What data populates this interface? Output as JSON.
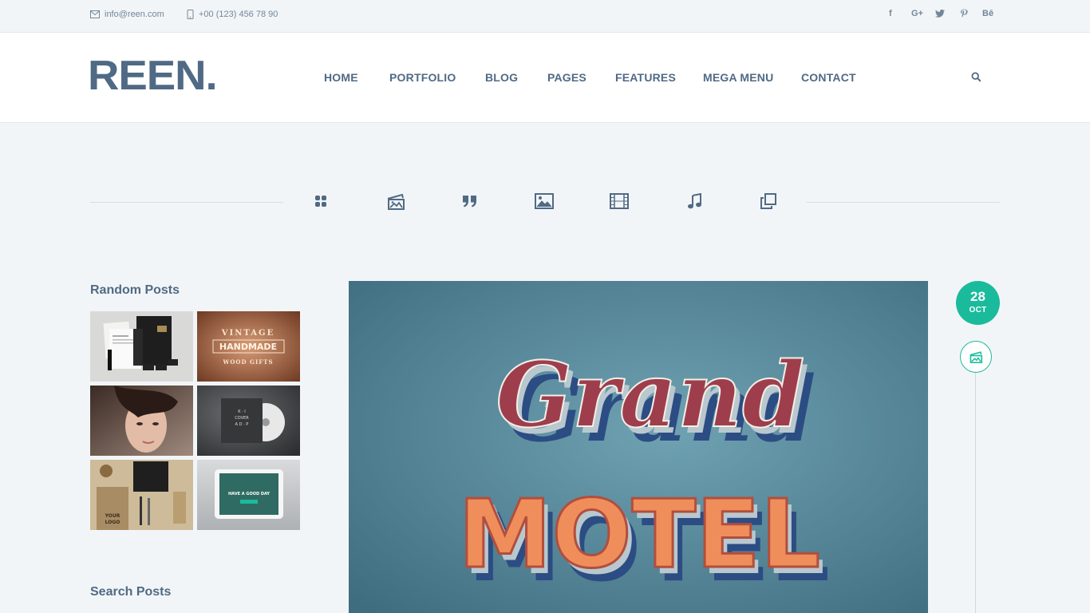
{
  "topbar": {
    "email": "info@reen.com",
    "phone": "+00 (123) 456 78 90",
    "social": [
      "f",
      "G+",
      "twitter",
      "pinterest",
      "Bē"
    ]
  },
  "header": {
    "logo": "REEN.",
    "nav": [
      "HOME",
      "PORTFOLIO",
      "BLOG",
      "PAGES",
      "FEATURES",
      "MEGA MENU",
      "CONTACT"
    ]
  },
  "filters": [
    "grid-icon",
    "image-gallery-icon",
    "quote-icon",
    "image-icon",
    "film-icon",
    "music-icon",
    "copy-icon"
  ],
  "sidebar": {
    "random_posts_title": "Random Posts",
    "search_posts_title": "Search Posts",
    "thumb_texts": {
      "vintage_top": "VINTAGE",
      "vintage_mid": "HANDMADE",
      "vintage_bot": "WOOD GIFTS",
      "tablet_text": "HAVE A GOOD DAY"
    }
  },
  "post": {
    "image_line1": "Grand",
    "image_line2": "MOTEL",
    "date_day": "28",
    "date_month": "OCT"
  },
  "colors": {
    "accent": "#1abb9c",
    "text": "#506a85",
    "background": "#f2f5f7"
  }
}
